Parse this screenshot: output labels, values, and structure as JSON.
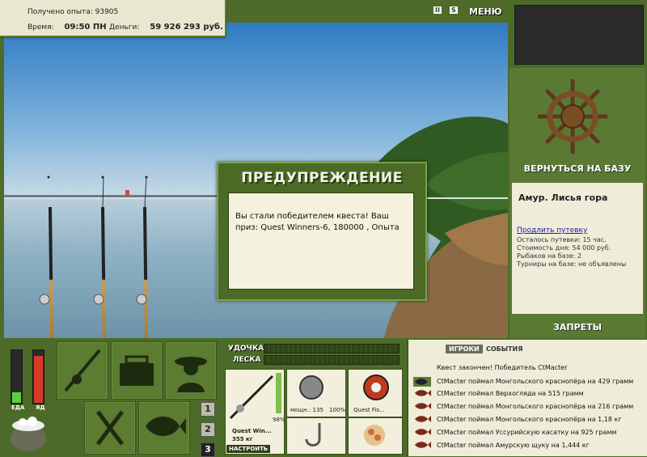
{
  "status": {
    "exp_label": "Получено опыта:",
    "exp_value": "93905",
    "time_label": "Время:",
    "time_value": "09:50 ПН",
    "money_label": "Деньги:",
    "money_value": "59 926 293 руб."
  },
  "top_buttons": {
    "pause": "II",
    "sound": "S",
    "menu": "МЕНЮ"
  },
  "right_panel": {
    "return_label": "ВЕРНУТЬСЯ НА БАЗУ",
    "location": "Амур. Лисья гора",
    "extend_link": "Продлить путевку",
    "trip_left": "Осталось путевки: 15 час.",
    "day_cost": "Стоимость дня: 54 000 руб.",
    "fishers": "Рыбаков на базе: 2",
    "tournaments": "Турниры на базе: не объявлены",
    "bans_label": "ЗАПРЕТЫ"
  },
  "dialog": {
    "title": "ПРЕДУПРЕЖДЕНИЕ",
    "message": "Вы стали победителем квеста! Ваш приз: Quest Winners-6, 180000 , Опыта"
  },
  "gauges": {
    "food_label": "ЕДА",
    "poison_label": "ЯД",
    "food_level": 0.2,
    "poison_level": 0.9
  },
  "page_buttons": [
    "1",
    "2",
    "3"
  ],
  "tackle": {
    "rod_label": "УДОЧКА",
    "line_label": "ЛЕСКА",
    "rod_name": "Quest Win...",
    "rod_weight": "355 кг",
    "rod_percent": "98%",
    "reel_power": "мощн.: 135",
    "reel_percent": "100%",
    "line_name": "Quest Fis...",
    "setup_button": "НАСТРОИТЬ"
  },
  "log": {
    "tab_players": "ИГРОКИ",
    "tab_events": "СОБЫТИЯ",
    "lines": [
      "Квест закончен! Победитель CtMacter",
      "CtMacter поймал Монгольского краснопёра на 429 грамм",
      "CtMacter поймал Верхогляда на 515 грамм",
      "CtMacter поймал Монгольского краснопёра на 216 грамм",
      "CtMacter поймал Монгольского краснопёра на 1,18 кг",
      "CtMacter поймал Уссурийскую касатку на 925 грамм",
      "CtMacter поймал Амурскую щуку на 1,444 кг"
    ]
  },
  "colors": {
    "panel_green": "#4c6b28",
    "cream": "#efedd9",
    "water": "#8fb1c4",
    "sky": "#3f86c9"
  }
}
